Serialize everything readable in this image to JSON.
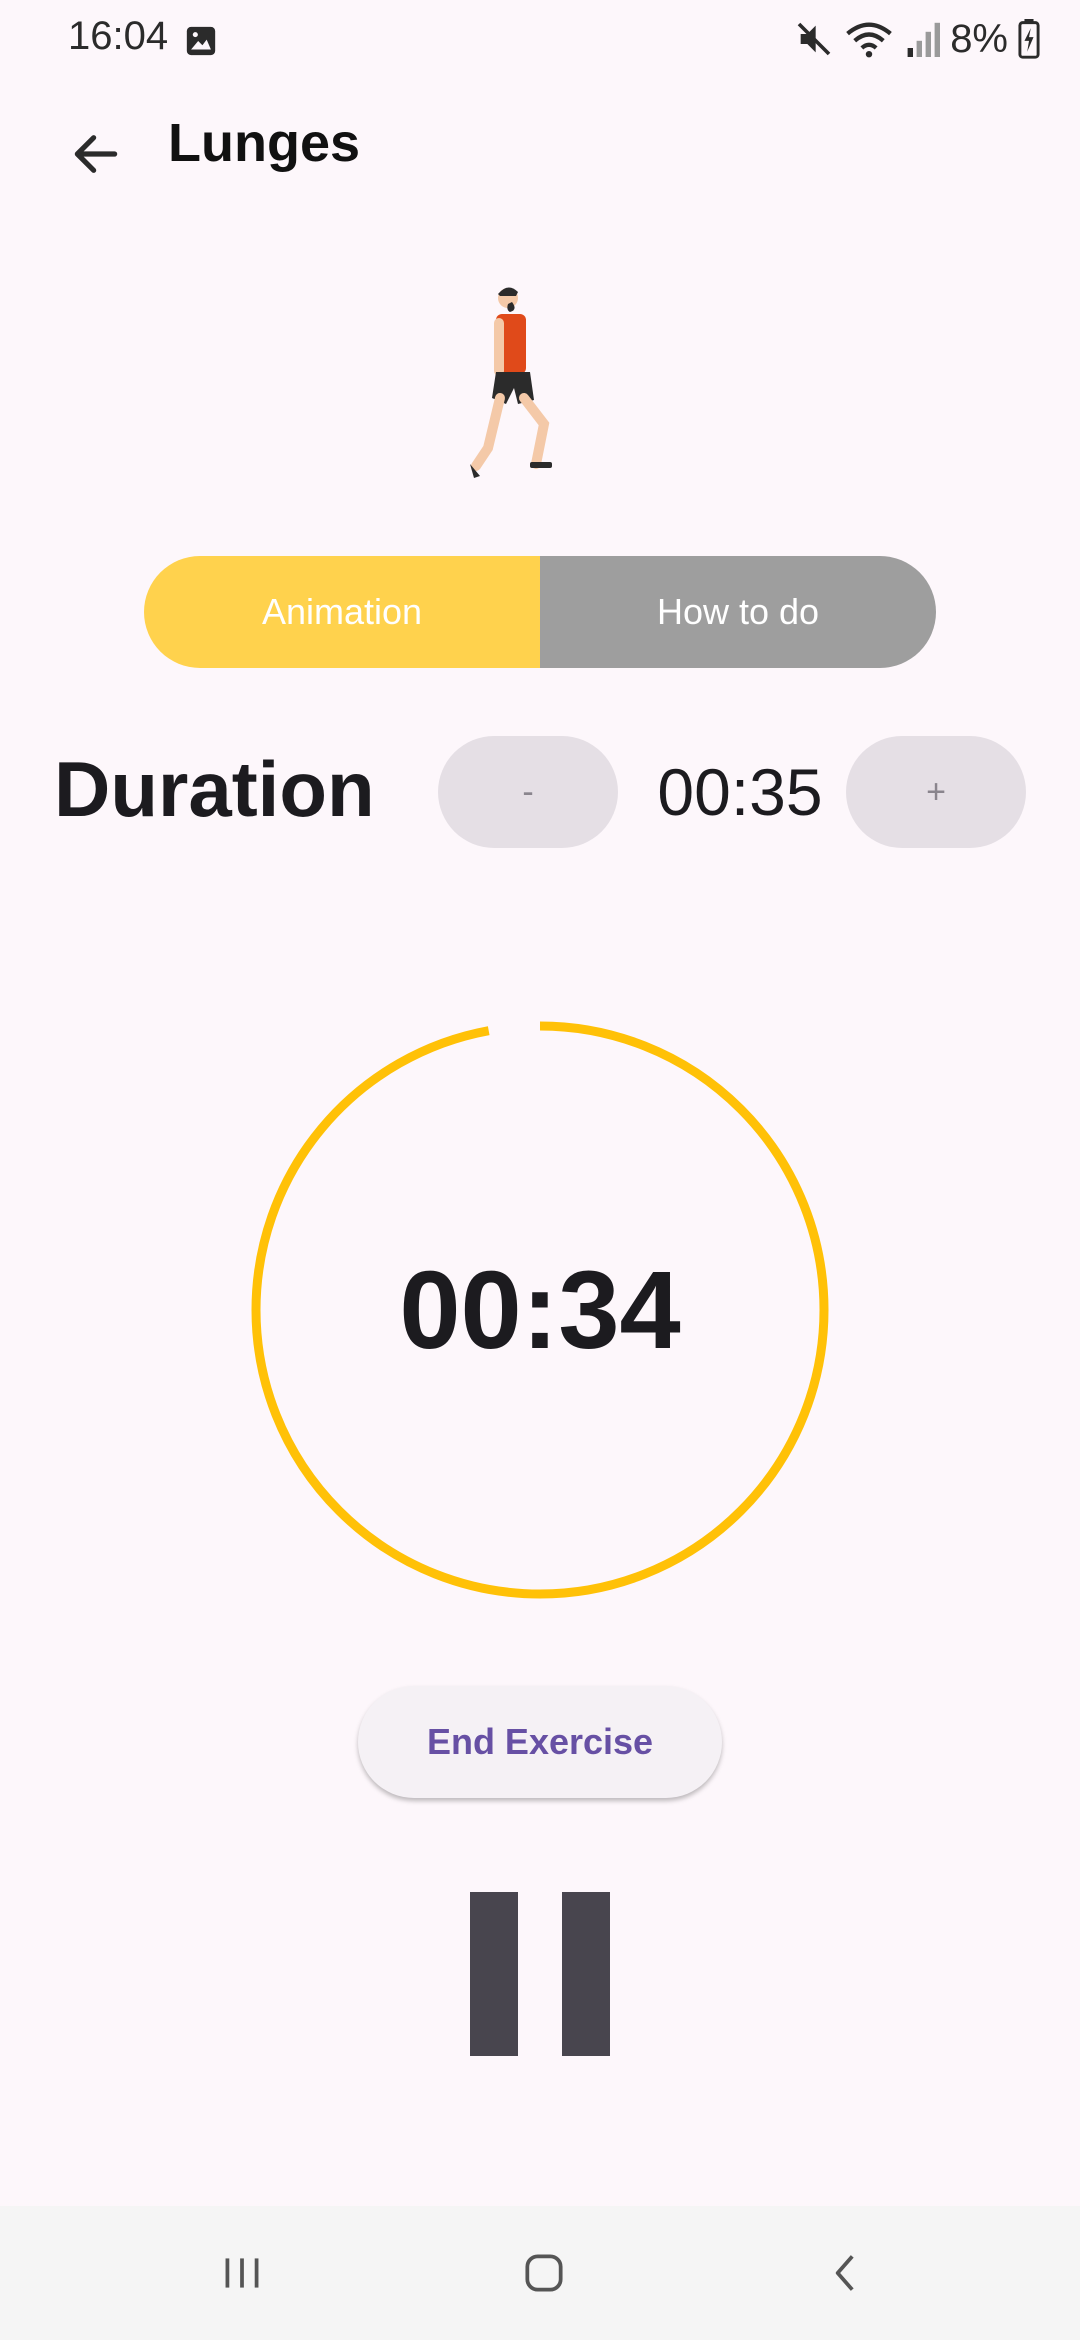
{
  "status_bar": {
    "time": "16:04",
    "battery": "8%",
    "icons": [
      "gallery-icon",
      "mute-icon",
      "wifi-icon",
      "signal-icon",
      "battery-charging-icon"
    ]
  },
  "header": {
    "title": "Lunges",
    "back_icon": "back-arrow-icon"
  },
  "toggle": {
    "animation_label": "Animation",
    "howto_label": "How to do",
    "selected": "Animation"
  },
  "duration": {
    "label": "Duration",
    "minus_label": "-",
    "plus_label": "+",
    "value": "00:35"
  },
  "timer": {
    "remaining": "00:34",
    "progress": 0.971
  },
  "actions": {
    "end_label": "End Exercise",
    "pause_icon": "pause-icon"
  },
  "nav": {
    "recents_icon": "recents-icon",
    "home_icon": "home-icon",
    "back_icon": "nav-back-icon"
  },
  "colors": {
    "accent": "#ffc107",
    "toggle_selected": "#ffd24d",
    "toggle_unselected": "#9e9e9e",
    "end_text": "#6750a4",
    "background": "#fdf7fb"
  }
}
